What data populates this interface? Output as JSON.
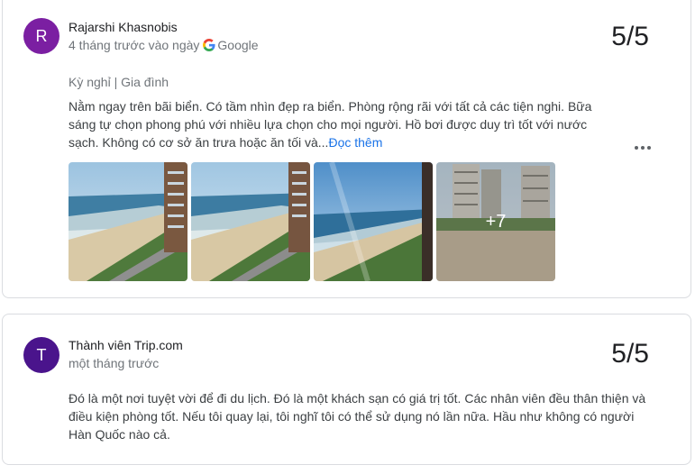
{
  "reviews": [
    {
      "avatar_letter": "R",
      "avatar_color": "#7b1fa2",
      "author": "Rajarshi Khasnobis",
      "time": "4 tháng trước vào ngày",
      "source": "Google",
      "score": "5/5",
      "tags": "Kỳ nghỉ | Gia đình",
      "text": "Nằm ngay trên bãi biển. Có tầm nhìn đẹp ra biển. Phòng rộng rãi với tất cả các tiện nghi. Bữa sáng tự chọn phong phú với nhiều lựa chọn cho mọi người. Hồ bơi được duy trì tốt với nước sạch. Không có cơ sở ăn trưa hoặc ăn tối và...",
      "read_more": "Đọc thêm",
      "more_photos": "+7"
    },
    {
      "avatar_letter": "T",
      "avatar_color": "#4a148c",
      "author": "Thành viên Trip.com",
      "time": "một tháng trước",
      "score": "5/5",
      "text": "Đó là một nơi tuyệt vời để đi du lịch. Đó là một khách sạn có giá trị tốt. Các nhân viên đều thân thiện và điều kiện phòng tốt. Nếu tôi quay lại, tôi nghĩ tôi có thể sử dụng nó lần nữa. Hầu như không có người Hàn Quốc nào cả."
    }
  ],
  "colors": {
    "link": "#1a73e8",
    "muted": "#70757a",
    "border": "#dadce0"
  },
  "icons": [
    "google-g-icon",
    "more-options-icon"
  ]
}
